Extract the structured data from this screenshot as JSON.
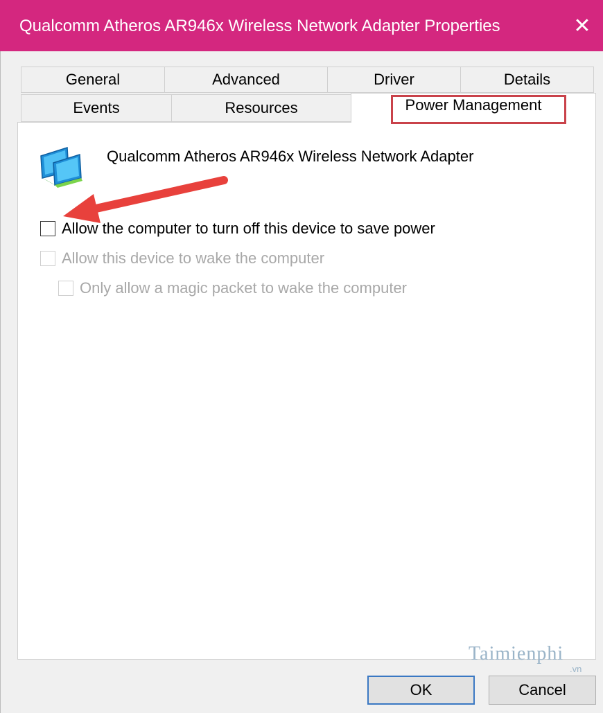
{
  "window": {
    "title": "Qualcomm Atheros AR946x Wireless Network Adapter Properties",
    "close_glyph": "✕",
    "titlebar_color": "#d4277f"
  },
  "tabs": {
    "row1": [
      "General",
      "Advanced",
      "Driver",
      "Details"
    ],
    "row2": [
      "Events",
      "Resources",
      "Power Management"
    ],
    "active": "Power Management"
  },
  "device": {
    "icon": "network-adapter-icon",
    "name": "Qualcomm Atheros AR946x Wireless Network Adapter"
  },
  "options": [
    {
      "label": "Allow the computer to turn off this device to save power",
      "checked": false,
      "enabled": true
    },
    {
      "label": "Allow this device to wake the computer",
      "checked": false,
      "enabled": false
    },
    {
      "label": "Only allow a magic packet to wake the computer",
      "checked": false,
      "enabled": false
    }
  ],
  "annotation": {
    "highlight_color": "#c9424a",
    "arrow_color": "#e8413c"
  },
  "watermark": {
    "text": "Taimienphi",
    "sub": ".vn"
  },
  "buttons": {
    "ok": "OK",
    "cancel": "Cancel"
  }
}
